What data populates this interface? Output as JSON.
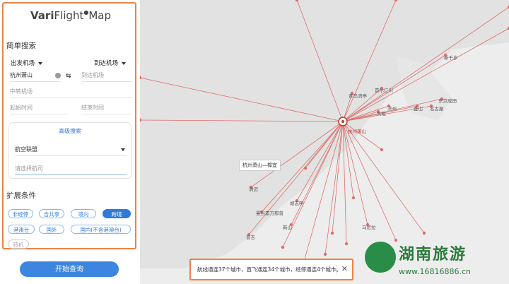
{
  "app": {
    "logo_prefix": "Vari",
    "logo_mid": "Flight",
    "logo_suffix": "Map"
  },
  "simple_search": {
    "heading": "简单搜索",
    "departure_select": "出发机场",
    "arrival_select": "到达机场",
    "departure_value": "杭州萧山",
    "arrival_placeholder": "到达机场",
    "transfer_placeholder": "中转机场",
    "start_time_placeholder": "起始时间",
    "end_time_placeholder": "结束时间"
  },
  "advanced": {
    "title": "高级搜索",
    "alliance": "航空联盟",
    "airline_placeholder": "请选择航司"
  },
  "extend": {
    "heading": "扩展条件",
    "tags": [
      {
        "label": "非经停",
        "state": "normal"
      },
      {
        "label": "含共享",
        "state": "normal"
      },
      {
        "label": "境内",
        "state": "normal"
      },
      {
        "label": "跨境",
        "state": "active"
      },
      {
        "label": "港澳台",
        "state": "normal"
      },
      {
        "label": "国外",
        "state": "normal"
      },
      {
        "label": "国内(不含港澳台)",
        "state": "normal"
      },
      {
        "label": "转机",
        "state": "disabled"
      }
    ]
  },
  "start_button": "开始查询",
  "status_bar": {
    "text": "航线通连37个城市，直飞通连34个城市，经停通连4个城市。",
    "close": "✕"
  },
  "map": {
    "tooltip": "杭州萧山—樟宜",
    "hub_label": "杭州萧山",
    "cities": [
      "新千岁",
      "首尔仁川",
      "釜山",
      "济州",
      "大阪",
      "东京成田",
      "名古屋",
      "青岛流亭",
      "曼谷素万那普",
      "普吉",
      "新山",
      "清迈",
      "胡志明",
      "马尼拉"
    ]
  },
  "watermark": {
    "title": "湖南旅游",
    "url": "www.16816886.cn"
  },
  "colors": {
    "accent_orange": "#e8844a",
    "primary_blue": "#3d86e0",
    "route_red": "#d9534f"
  }
}
